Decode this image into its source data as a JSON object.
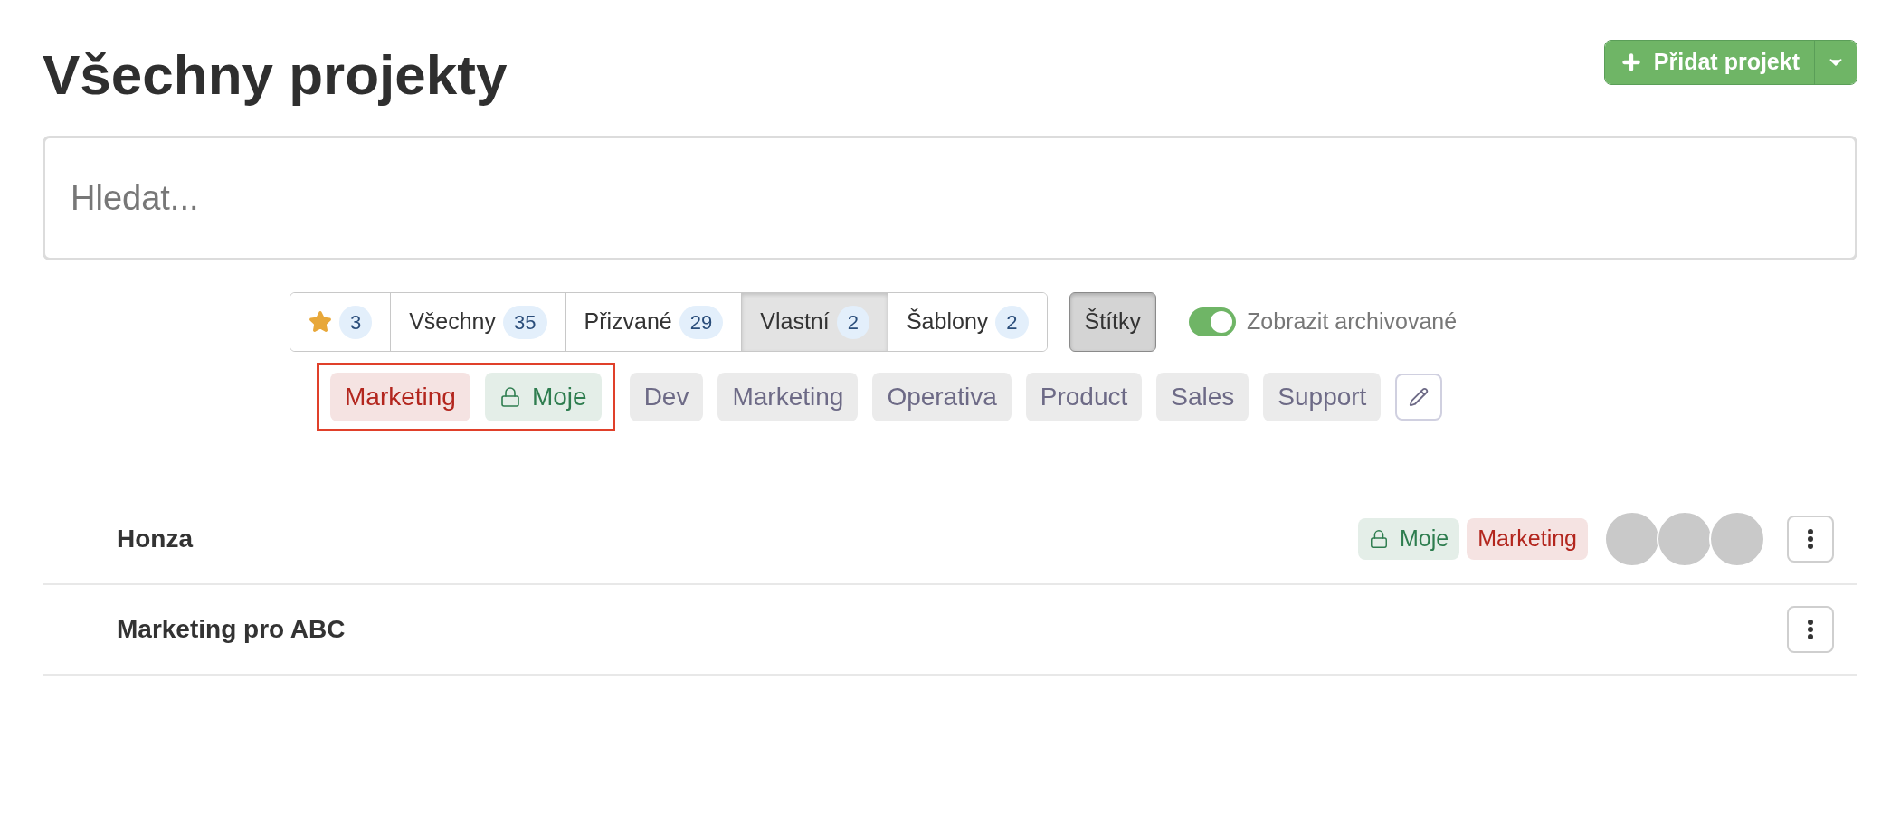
{
  "title": "Všechny projekty",
  "add_button": {
    "label": "Přidat projekt"
  },
  "search": {
    "placeholder": "Hledat..."
  },
  "tabs": [
    {
      "kind": "star",
      "count": "3",
      "selected": false
    },
    {
      "kind": "text",
      "label": "Všechny",
      "count": "35",
      "selected": false
    },
    {
      "kind": "text",
      "label": "Přizvané",
      "count": "29",
      "selected": false
    },
    {
      "kind": "text",
      "label": "Vlastní",
      "count": "2",
      "selected": true
    },
    {
      "kind": "text",
      "label": "Šablony",
      "count": "2",
      "selected": false
    }
  ],
  "tags_toggle": {
    "label": "Štítky",
    "on": true
  },
  "archived_switch": {
    "label": "Zobrazit archivované",
    "on": true
  },
  "selected_tags": [
    {
      "label": "Marketing",
      "color": "#b3261e",
      "locked": false
    },
    {
      "label": "Moje",
      "color": "#2e7d4f",
      "locked": true
    }
  ],
  "available_tags": [
    {
      "label": "Dev"
    },
    {
      "label": "Marketing"
    },
    {
      "label": "Operativa"
    },
    {
      "label": "Product"
    },
    {
      "label": "Sales"
    },
    {
      "label": "Support"
    }
  ],
  "projects": [
    {
      "name": "Honza",
      "tags": [
        {
          "label": "Moje",
          "color": "#2e7d4f",
          "locked": true
        },
        {
          "label": "Marketing",
          "color": "#b3261e",
          "locked": false
        }
      ],
      "avatars": [
        {
          "kind": "photo"
        },
        {
          "kind": "photo"
        },
        {
          "kind": "photo"
        }
      ]
    },
    {
      "name": "Marketing pro ABC"
    }
  ]
}
